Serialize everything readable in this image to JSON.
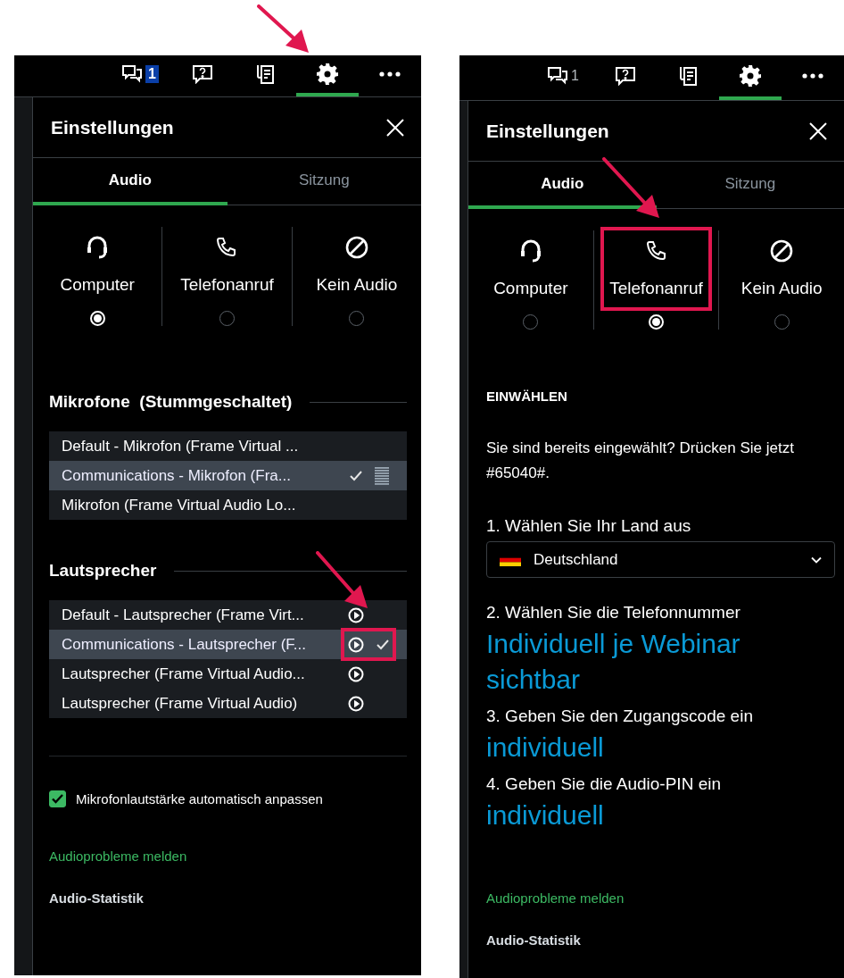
{
  "panels": [
    {
      "settings_arrow": true,
      "toolbar": [
        {
          "kind": "chat",
          "badge": "1",
          "badge_filled": true,
          "selected": false
        },
        {
          "kind": "help",
          "selected": false
        },
        {
          "kind": "notes",
          "selected": false
        },
        {
          "kind": "settings",
          "selected": true
        },
        {
          "kind": "more",
          "selected": false
        }
      ],
      "title": "Einstellungen",
      "tabs": [
        {
          "label": "Audio",
          "selected": true
        },
        {
          "label": "Sitzung",
          "selected": false
        }
      ],
      "options": [
        {
          "kind": "computer",
          "label": "Computer",
          "selected": true,
          "annotated": false
        },
        {
          "kind": "phone",
          "label": "Telefonanruf",
          "selected": false,
          "annotated": false
        },
        {
          "kind": "none",
          "label": "Kein Audio",
          "selected": false,
          "annotated": false
        }
      ],
      "microphones": {
        "title": "Mikrofone  (Stummgeschaltet)",
        "items": [
          {
            "label": "Default - Mikrofon (Frame Virtual ...",
            "selected": false
          },
          {
            "label": "Communications - Mikrofon (Fra...",
            "selected": true
          },
          {
            "label": "Mikrofon (Frame Virtual Audio Lo...",
            "selected": false
          }
        ]
      },
      "speakers": {
        "title": "Lautsprecher",
        "items": [
          {
            "label": "Default - Lautsprecher (Frame Virt...",
            "selected": false,
            "annotated": false
          },
          {
            "label": "Communications - Lautsprecher (F...",
            "selected": true,
            "annotated": true
          },
          {
            "label": "Lautsprecher (Frame Virtual Audio...",
            "selected": false,
            "annotated": false
          },
          {
            "label": "Lautsprecher (Frame Virtual Audio)",
            "selected": false,
            "annotated": false
          }
        ]
      },
      "auto_adjust": {
        "label": "Mikrofonlautstärke automatisch anpassen",
        "checked": true
      },
      "report_link": "Audioprobleme melden",
      "statistics": "Audio-Statistik"
    },
    {
      "settings_arrow": false,
      "toolbar": [
        {
          "kind": "chat",
          "badge": "1",
          "badge_filled": false,
          "selected": false
        },
        {
          "kind": "help",
          "selected": false
        },
        {
          "kind": "notes",
          "selected": false
        },
        {
          "kind": "settings",
          "selected": true
        },
        {
          "kind": "more",
          "selected": false
        }
      ],
      "title": "Einstellungen",
      "tabs": [
        {
          "label": "Audio",
          "selected": true
        },
        {
          "label": "Sitzung",
          "selected": false
        }
      ],
      "options": [
        {
          "kind": "computer",
          "label": "Computer",
          "selected": false,
          "annotated": false
        },
        {
          "kind": "phone",
          "label": "Telefonanruf",
          "selected": true,
          "annotated": true
        },
        {
          "kind": "none",
          "label": "Kein Audio",
          "selected": false,
          "annotated": false
        }
      ],
      "dial_in": {
        "title": "EINWÄHLEN",
        "note": "Sie sind bereits eingewählt? Drücken Sie jetzt #65040#.",
        "country_label": "1. Wählen Sie Ihr Land aus",
        "country": "Deutschland",
        "steps": [
          {
            "label": "2. Wählen Sie die Telefonnummer",
            "value": "Individuell je Webinar sichtbar"
          },
          {
            "label": "3. Geben Sie den Zugangscode ein",
            "value": "individuell"
          },
          {
            "label": "4. Geben Sie die Audio-PIN ein",
            "value": "individuell"
          }
        ]
      },
      "report_link": "Audioprobleme melden",
      "statistics": "Audio-Statistik"
    }
  ]
}
